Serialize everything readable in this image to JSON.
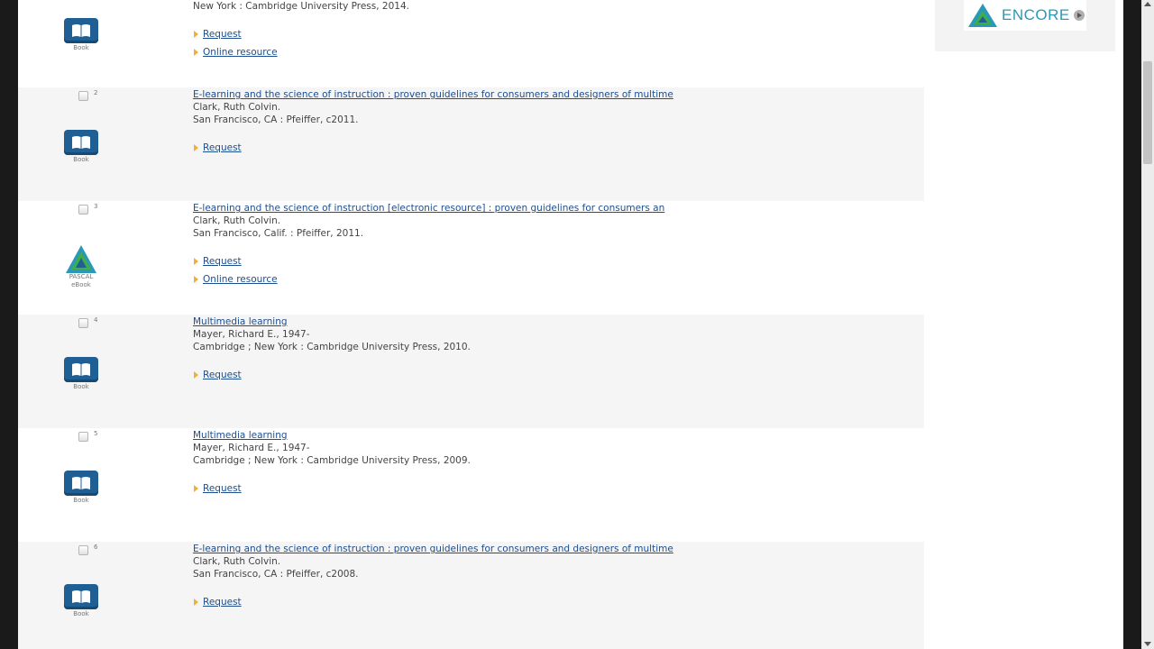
{
  "first_result": {
    "publisher": "New York : Cambridge University Press, 2014.",
    "icon_label": "Book",
    "links": [
      "Request",
      "Online resource"
    ]
  },
  "results": [
    {
      "number": "2",
      "title": "E-learning and the science of instruction : proven guidelines for consumers and designers of multime",
      "author": "Clark, Ruth Colvin.",
      "publisher": "San Francisco, CA : Pfeiffer, c2011.",
      "icon_label": "Book",
      "links": [
        "Request"
      ]
    },
    {
      "number": "3",
      "title": "E-learning and the science of instruction [electronic resource] : proven guidelines for consumers an",
      "author": "Clark, Ruth Colvin.",
      "publisher": "San Francisco, Calif. : Pfeiffer, 2011.",
      "icon_label": "PASCAL eBook",
      "links": [
        "Request",
        "Online resource"
      ]
    },
    {
      "number": "4",
      "title": "Multimedia learning",
      "author": "Mayer, Richard E., 1947-",
      "publisher": "Cambridge ; New York : Cambridge University Press, 2010.",
      "icon_label": "Book",
      "links": [
        "Request"
      ]
    },
    {
      "number": "5",
      "title": "Multimedia learning",
      "author": "Mayer, Richard E., 1947-",
      "publisher": "Cambridge ; New York : Cambridge University Press, 2009.",
      "icon_label": "Book",
      "links": [
        "Request"
      ]
    },
    {
      "number": "6",
      "title": "E-learning and the science of instruction : proven guidelines for consumers and designers of multime",
      "author": "Clark, Ruth Colvin.",
      "publisher": "San Francisco, CA : Pfeiffer, c2008.",
      "icon_label": "Book",
      "links": [
        "Request"
      ]
    }
  ],
  "sidebar": {
    "logo_text": "ENCORE"
  },
  "colors": {
    "link": "#1d4e8f",
    "accent_arrow": "#f0b030",
    "book_icon": "#1f5f94",
    "encore": "#2a98b8"
  }
}
